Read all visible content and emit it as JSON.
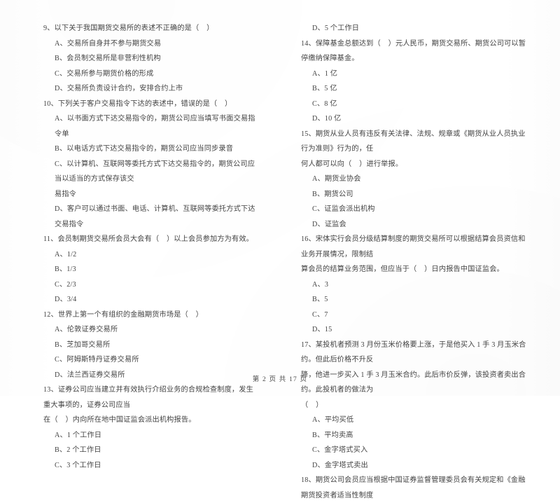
{
  "document": {
    "type": "exam-paper",
    "language": "zh-CN",
    "footer": "第 2 页 共 17 页"
  },
  "left_column": {
    "questions": [
      {
        "number": "9",
        "stem": "9、以下关于我国期货交易所的表述不正确的是（    ）",
        "options": [
          "A、交易所自身并不参与期货交易",
          "B、会员制交易所是非营利性机构",
          "C、交易所参与期货价格的形成",
          "D、交易所负责设计合约，安排合约上市"
        ]
      },
      {
        "number": "10",
        "stem": "10、下列关于客户交易指令下达的表述中，错误的是（    ）",
        "options": [
          "A、以书面方式下达交易指令的，期货公司应当填写书面交易指令单",
          "B、以电话方式下达交易指令的，期货公司应当同步录音",
          "C、以计算机、互联网等委托方式下达交易指令的，期货公司应当以适当的方式保存该交\n易指令",
          "D、客户可以通过书面、电话、计算机、互联网等委托方式下达交易指令"
        ]
      },
      {
        "number": "11",
        "stem": "11、会员制期货交易所会员大会有（    ）以上会员参加方为有效。",
        "options": [
          "A、1/2",
          "B、1/3",
          "C、2/3",
          "D、3/4"
        ]
      },
      {
        "number": "12",
        "stem": "12、世界上第一个有组织的金融期货市场是（    ）",
        "options": [
          "A、伦敦证券交易所",
          "B、芝加哥交易所",
          "C、阿姆斯特丹证券交易所",
          "D、法兰西证券交易所"
        ]
      },
      {
        "number": "13",
        "stem": "13、证券公司应当建立并有效执行介绍业务的合规检查制度，发生重大事项的，证券公司应当\n在（    ）内向所在地中国证监会派出机构报告。",
        "options": [
          "A、1 个工作日",
          "B、2 个工作日",
          "C、3 个工作日"
        ]
      }
    ]
  },
  "right_column": {
    "continuation_option": "D、5 个工作日",
    "questions": [
      {
        "number": "14",
        "stem": "14、保障基金总额达到（    ）元人民币，期货交易所、期货公司可以暂停缴纳保障基金。",
        "options": [
          "A、1 亿",
          "B、5 亿",
          "C、8 亿",
          "D、10 亿"
        ]
      },
      {
        "number": "15",
        "stem": "15、期货从业人员有违反有关法律、法规、规章或《期货从业人员执业行为准则》行为的，任\n何人都可以向（    ）进行举报。",
        "options": [
          "A、期货业协会",
          "B、期货公司",
          "C、证监会派出机构",
          "D、证监会"
        ]
      },
      {
        "number": "16",
        "stem": "16、宋体实行会员分级结算制度的期货交易所可以根据结算会员资信和业务开展情况，限制结\n算会员的结算业务范围，但应当于（    ）日内报告中国证监会。",
        "options": [
          "A、3",
          "B、5",
          "C、7",
          "D、15"
        ]
      },
      {
        "number": "17",
        "stem": "17、某投机者预测 3 月份玉米价格要上涨，于是他买入 1 手 3 月玉米合约。但此后价格不升反\n降，他进一步买入 1 手 3 月玉米合约。此后市价反弹，该投资者卖出合约。此投机者的做法为\n（    ）",
        "options": [
          "A、平均买低",
          "B、平均卖高",
          "C、金字塔式买入",
          "D、金字塔式卖出"
        ]
      },
      {
        "number": "18",
        "stem": "18、期货公司会员应当根据中国证券监督管理委员会有关规定和《金融期货投资者适当性制度",
        "options": []
      }
    ]
  }
}
